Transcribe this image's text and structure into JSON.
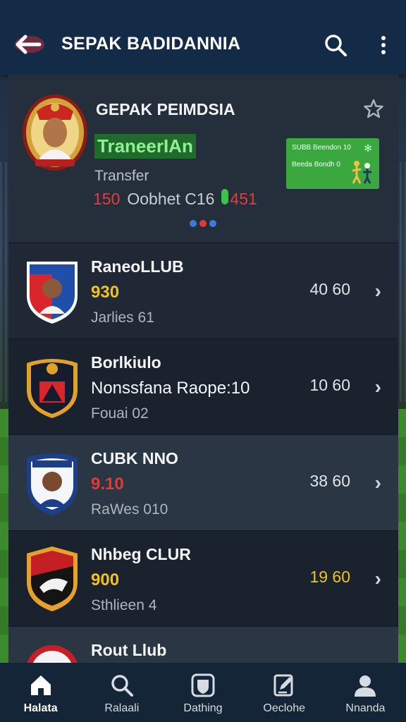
{
  "appbar": {
    "title": "SEPAK BADIDANNIA",
    "back_icon": "back-arrow-icon",
    "search_icon": "search-icon",
    "more_icon": "more-vertical-icon"
  },
  "featured": {
    "title": "GEPAK PEIMDSIA",
    "badge": "TraneerIAn",
    "label": "Transfer",
    "stat_left": "150",
    "stat_mid": "Oobhet C16",
    "stat_right": "451",
    "promo_line1": "SUBB Beendon 10",
    "promo_line2": "Beeda Bondh 0",
    "star_icon": "star-outline-icon"
  },
  "clubs": [
    {
      "name": "RaneoLLUB",
      "value": "930",
      "value_color": "#f2c219",
      "sub": "Jarlies 61",
      "score": "40 60",
      "score_color": "#e1e4e9"
    },
    {
      "name": "Borlkiulo",
      "value": "Nonssfana Raope:10",
      "value_color": "#f5f6f8",
      "sub": "Fouai 02",
      "score": "10 60",
      "score_color": "#e1e4e9"
    },
    {
      "name": "CUBK NNO",
      "value": "9.10",
      "value_color": "#e23a34",
      "sub": "RaWes 010",
      "score": "38 60",
      "score_color": "#e1e4e9"
    },
    {
      "name": "Nhbeg CLUR",
      "value": "900",
      "value_color": "#f2c219",
      "sub": "Sthlieen 4",
      "score": "19 60",
      "score_color": "#f2c219"
    },
    {
      "name": "Rout Llub",
      "value": "",
      "value_color": "#f5f6f8",
      "sub": "",
      "score": "",
      "score_color": "#e1e4e9"
    }
  ],
  "nav": [
    {
      "label": "Halata",
      "icon": "home-icon"
    },
    {
      "label": "Ralaali",
      "icon": "search-icon"
    },
    {
      "label": "Dathing",
      "icon": "shield-icon"
    },
    {
      "label": "Oeclohe",
      "icon": "document-edit-icon"
    },
    {
      "label": "Nnanda",
      "icon": "profile-icon"
    }
  ],
  "colors": {
    "appbar": "#142b47",
    "accent_green": "#3aa83e",
    "accent_yellow": "#f2c219",
    "accent_red": "#e23a34"
  }
}
